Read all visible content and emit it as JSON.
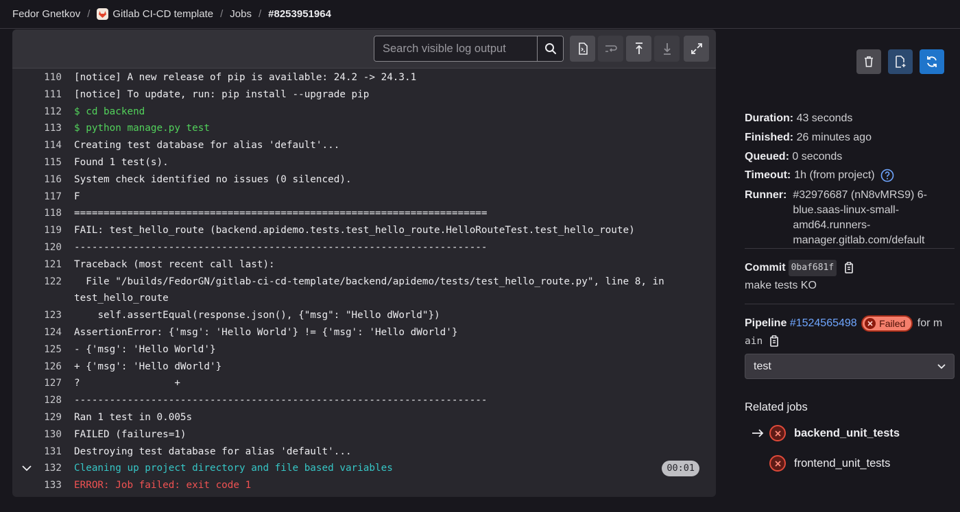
{
  "breadcrumb": {
    "user": "Fedor Gnetkov",
    "project": "Gitlab CI-CD template",
    "section": "Jobs",
    "job": "#8253951964"
  },
  "log": {
    "search_placeholder": "Search visible log output",
    "lines": [
      {
        "num": "110",
        "text": "[notice] A new release of pip is available: 24.2 -> 24.3.1",
        "style": "normal"
      },
      {
        "num": "111",
        "text": "[notice] To update, run: pip install --upgrade pip",
        "style": "normal"
      },
      {
        "num": "112",
        "text": "$ cd backend",
        "style": "green"
      },
      {
        "num": "113",
        "text": "$ python manage.py test",
        "style": "green"
      },
      {
        "num": "114",
        "text": "Creating test database for alias 'default'...",
        "style": "normal"
      },
      {
        "num": "115",
        "text": "Found 1 test(s).",
        "style": "normal"
      },
      {
        "num": "116",
        "text": "System check identified no issues (0 silenced).",
        "style": "normal"
      },
      {
        "num": "117",
        "text": "F",
        "style": "normal"
      },
      {
        "num": "118",
        "text": "======================================================================",
        "style": "normal"
      },
      {
        "num": "119",
        "text": "FAIL: test_hello_route (backend.apidemo.tests.test_hello_route.HelloRouteTest.test_hello_route)",
        "style": "normal"
      },
      {
        "num": "120",
        "text": "----------------------------------------------------------------------",
        "style": "normal"
      },
      {
        "num": "121",
        "text": "Traceback (most recent call last):",
        "style": "normal"
      },
      {
        "num": "122",
        "text": "  File \"/builds/FedorGN/gitlab-ci-cd-template/backend/apidemo/tests/test_hello_route.py\", line 8, in test_hello_route",
        "style": "normal"
      },
      {
        "num": "123",
        "text": "    self.assertEqual(response.json(), {\"msg\": \"Hello dWorld\"})",
        "style": "normal"
      },
      {
        "num": "124",
        "text": "AssertionError: {'msg': 'Hello World'} != {'msg': 'Hello dWorld'}",
        "style": "normal"
      },
      {
        "num": "125",
        "text": "- {'msg': 'Hello World'}",
        "style": "normal"
      },
      {
        "num": "126",
        "text": "+ {'msg': 'Hello dWorld'}",
        "style": "normal"
      },
      {
        "num": "127",
        "text": "?                +",
        "style": "normal"
      },
      {
        "num": "128",
        "text": "----------------------------------------------------------------------",
        "style": "normal"
      },
      {
        "num": "129",
        "text": "Ran 1 test in 0.005s",
        "style": "normal"
      },
      {
        "num": "130",
        "text": "FAILED (failures=1)",
        "style": "normal"
      },
      {
        "num": "131",
        "text": "Destroying test database for alias 'default'...",
        "style": "normal"
      },
      {
        "num": "132",
        "text": "Cleaning up project directory and file based variables",
        "style": "cyan",
        "duration": "00:01",
        "collapsible": true
      },
      {
        "num": "133",
        "text": "ERROR: Job failed: exit code 1",
        "style": "red"
      }
    ]
  },
  "sidebar": {
    "duration_label": "Duration:",
    "duration_value": "43 seconds",
    "finished_label": "Finished:",
    "finished_value": "26 minutes ago",
    "queued_label": "Queued:",
    "queued_value": "0 seconds",
    "timeout_label": "Timeout:",
    "timeout_value": "1h (from project)",
    "runner_label": "Runner:",
    "runner_value_lines": [
      "#32976687 (nN8vMRS9) 6-",
      "blue.saas-linux-small-",
      "amd64.runners-",
      "manager.gitlab.com/default"
    ],
    "commit_label": "Commit",
    "commit_sha": "0baf681f",
    "commit_message": "make tests KO",
    "pipeline_label": "Pipeline",
    "pipeline_id": "#1524565498",
    "pipeline_status": "Failed",
    "pipeline_for": "for m",
    "pipeline_branch_tail": "ain",
    "stage_selected": "test",
    "related_jobs_title": "Related jobs",
    "jobs": [
      {
        "name": "backend_unit_tests",
        "status": "failed",
        "current": true
      },
      {
        "name": "frontend_unit_tests",
        "status": "failed",
        "current": false
      }
    ]
  },
  "colors": {
    "background": "#18171d",
    "log_panel": "#28272d",
    "accent_blue": "#1f75cb",
    "link": "#6fa6ff",
    "failed": "#f57f6c",
    "green_command": "#52d25b",
    "cyan_section": "#36c6c6",
    "red_error": "#f05252"
  }
}
